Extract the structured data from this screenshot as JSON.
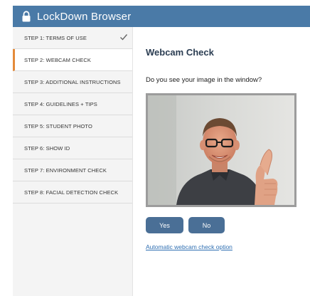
{
  "window": {
    "title": "LockDown Browser",
    "icon": "lock-icon"
  },
  "sidebar": {
    "items": [
      {
        "label": "STEP 1: TERMS OF USE",
        "completed": true,
        "active": false
      },
      {
        "label": "STEP 2: WEBCAM CHECK",
        "completed": false,
        "active": true
      },
      {
        "label": "STEP 3: ADDITIONAL INSTRUCTIONS",
        "completed": false,
        "active": false
      },
      {
        "label": "STEP 4: GUIDELINES + TIPS",
        "completed": false,
        "active": false
      },
      {
        "label": "STEP 5: STUDENT PHOTO",
        "completed": false,
        "active": false
      },
      {
        "label": "STEP 6: SHOW ID",
        "completed": false,
        "active": false
      },
      {
        "label": "STEP 7: ENVIRONMENT CHECK",
        "completed": false,
        "active": false
      },
      {
        "label": "STEP 8: FACIAL DETECTION CHECK",
        "completed": false,
        "active": false
      }
    ]
  },
  "main": {
    "heading": "Webcam Check",
    "question": "Do you see your image in the window?",
    "yes_label": "Yes",
    "no_label": "No",
    "link_text": "Automatic webcam check option"
  },
  "colors": {
    "titlebar": "#4a7aa7",
    "active_accent": "#e48a3a",
    "button": "#4a6f96",
    "link": "#2f6fb2"
  }
}
